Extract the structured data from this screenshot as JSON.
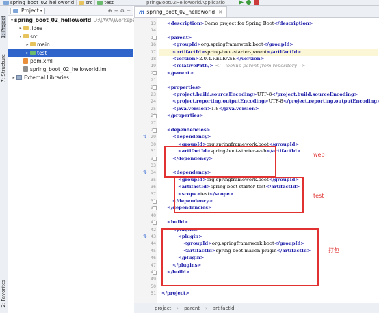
{
  "breadcrumb": [
    "spring_boot_02_helloworld",
    "src",
    "test"
  ],
  "editor_tab_fragment": "pringBoot02HelloworldApplicatio",
  "left_tabs": {
    "project": "1: Project",
    "structure": "7: Structure",
    "favorites": "2: Favorites"
  },
  "project_panel": {
    "selector_label": "Project",
    "tools": [
      "⊕",
      "÷",
      "⚙",
      "⊢"
    ],
    "tree": [
      {
        "label": "spring_boot_02_helloworld",
        "extra": "D:\\JAVA\\Workspace\\id",
        "arrow": "▾",
        "icon": "folder-blue",
        "indent": 0,
        "bold": true
      },
      {
        "label": ".idea",
        "arrow": "▸",
        "icon": "folder",
        "indent": 1
      },
      {
        "label": "src",
        "arrow": "▾",
        "icon": "folder",
        "indent": 1
      },
      {
        "label": "main",
        "arrow": "▸",
        "icon": "folder",
        "indent": 2
      },
      {
        "label": "test",
        "arrow": "▸",
        "icon": "folder-green",
        "indent": 2,
        "selected": true
      },
      {
        "label": "pom.xml",
        "arrow": "",
        "icon": "xml",
        "indent": 1
      },
      {
        "label": "spring_boot_02_helloworld.iml",
        "arrow": "",
        "icon": "iml",
        "indent": 1
      },
      {
        "label": "External Libraries",
        "arrow": "▸",
        "icon": "lib",
        "indent": 0
      }
    ]
  },
  "editor": {
    "tab_label": "spring_boot_02_helloworld",
    "lines": [
      {
        "n": "13",
        "text": "<description>Demo project for Spring Boot</description>"
      },
      {
        "n": "14",
        "text": ""
      },
      {
        "n": "15",
        "text": "<parent>"
      },
      {
        "n": "16",
        "text": "<groupId>org.springframework.boot</groupId>"
      },
      {
        "n": "17",
        "text": "<artifactId>spring-boot-starter-parent</artifactId>"
      },
      {
        "n": "18",
        "text": "<version>2.0.4.RELEASE</version>"
      },
      {
        "n": "19",
        "text": "<relativePath/> <!-- lookup parent from repository -->"
      },
      {
        "n": "20",
        "text": "</parent>"
      },
      {
        "n": "21",
        "text": ""
      },
      {
        "n": "22",
        "text": "<properties>"
      },
      {
        "n": "23",
        "text": "<project.build.sourceEncoding>UTF-8</project.build.sourceEncoding>"
      },
      {
        "n": "24",
        "text": "<project.reporting.outputEncoding>UTF-8</project.reporting.outputEncoding>"
      },
      {
        "n": "25",
        "text": "<java.version>1.8</java.version>"
      },
      {
        "n": "26",
        "text": "</properties>"
      },
      {
        "n": "27",
        "text": ""
      },
      {
        "n": "28",
        "text": "<dependencies>"
      },
      {
        "n": "29",
        "text": "<dependency>"
      },
      {
        "n": "30",
        "text": "<groupId>org.springframework.boot</groupId>"
      },
      {
        "n": "31",
        "text": "<artifactId>spring-boot-starter-web</artifactId>"
      },
      {
        "n": "32",
        "text": "</dependency>"
      },
      {
        "n": "33",
        "text": ""
      },
      {
        "n": "34",
        "text": "<dependency>"
      },
      {
        "n": "35",
        "text": "<groupId>org.springframework.boot</groupId>"
      },
      {
        "n": "36",
        "text": "<artifactId>spring-boot-starter-test</artifactId>"
      },
      {
        "n": "37",
        "text": "<scope>test</scope>"
      },
      {
        "n": "38",
        "text": "</dependency>"
      },
      {
        "n": "39",
        "text": "</dependencies>"
      },
      {
        "n": "40",
        "text": ""
      },
      {
        "n": "41",
        "text": "<build>"
      },
      {
        "n": "42",
        "text": "<plugins>"
      },
      {
        "n": "43",
        "text": "<plugin>"
      },
      {
        "n": "44",
        "text": "<groupId>org.springframework.boot</groupId>"
      },
      {
        "n": "45",
        "text": "<artifactId>spring-boot-maven-plugin</artifactId>"
      },
      {
        "n": "46",
        "text": "</plugin>"
      },
      {
        "n": "47",
        "text": "</plugins>"
      },
      {
        "n": "48",
        "text": "</build>"
      },
      {
        "n": "49",
        "text": ""
      },
      {
        "n": "50",
        "text": ""
      },
      {
        "n": "51",
        "text": "</project>"
      }
    ],
    "annotations": {
      "web": "web",
      "test": "test",
      "package": "打包"
    }
  },
  "status_path": [
    "project",
    "parent",
    "artifactId"
  ],
  "colors": {
    "annotation_red": "#e13131",
    "selection_blue": "#2f65ca",
    "tag_blue": "#1c1ca8"
  }
}
